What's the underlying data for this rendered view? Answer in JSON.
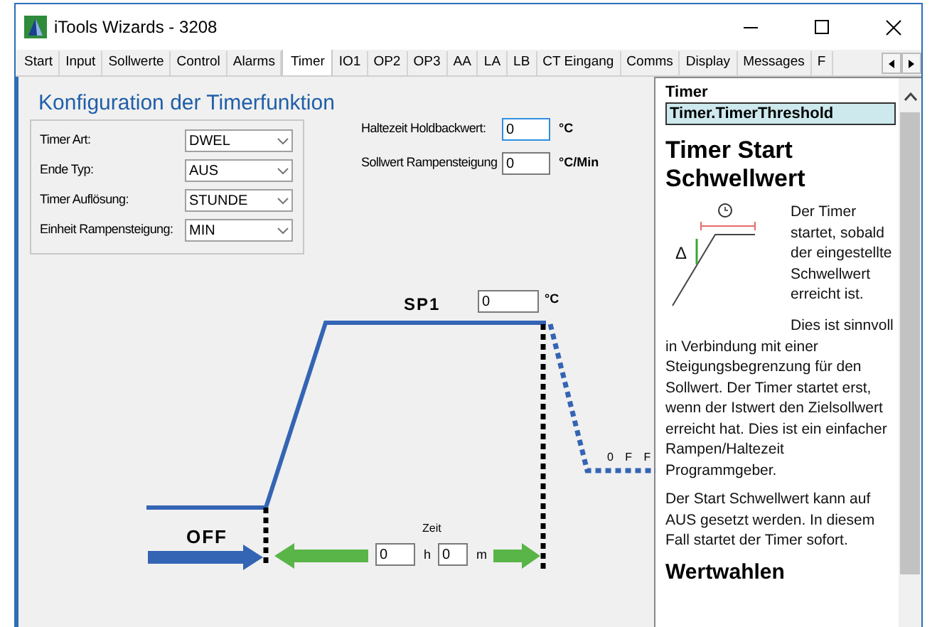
{
  "window": {
    "title": "iTools Wizards - 3208"
  },
  "tabs": [
    {
      "label": "Start",
      "selected": false
    },
    {
      "label": "Input",
      "selected": false
    },
    {
      "label": "Sollwerte",
      "selected": false
    },
    {
      "label": "Control",
      "selected": false
    },
    {
      "label": "Alarms",
      "selected": false
    },
    {
      "label": "Timer",
      "selected": true
    },
    {
      "label": "IO1",
      "selected": false
    },
    {
      "label": "OP2",
      "selected": false
    },
    {
      "label": "OP3",
      "selected": false
    },
    {
      "label": "AA",
      "selected": false
    },
    {
      "label": "LA",
      "selected": false
    },
    {
      "label": "LB",
      "selected": false
    },
    {
      "label": "CT Eingang",
      "selected": false
    },
    {
      "label": "Comms",
      "selected": false
    },
    {
      "label": "Display",
      "selected": false
    },
    {
      "label": "Messages",
      "selected": false
    },
    {
      "label": "F",
      "selected": false
    }
  ],
  "config": {
    "title": "Konfiguration der Timerfunktion",
    "settings": [
      {
        "label": "Timer Art:",
        "value": "DWEL"
      },
      {
        "label": "Ende Typ:",
        "value": "AUS"
      },
      {
        "label": "Timer Auflösung:",
        "value": "STUNDE"
      },
      {
        "label": "Einheit Rampensteigung:",
        "value": "MIN"
      }
    ],
    "fields": [
      {
        "label": "Haltezeit Holdbackwert:",
        "value": "0",
        "unit": "°C",
        "focused": true
      },
      {
        "label": "Sollwert Rampensteigung",
        "value": "0",
        "unit": "°C/Min",
        "focused": false
      }
    ]
  },
  "diagram": {
    "setpoint_label": "SP1",
    "setpoint_value": "0",
    "setpoint_unit": "°C",
    "off_label": "OFF",
    "end_label": "0 F F",
    "time_label": "Zeit",
    "hours": "0",
    "hours_unit": "h",
    "minutes": "0",
    "minutes_unit": "m"
  },
  "help": {
    "section": "Timer",
    "parameter": "Timer.TimerThreshold",
    "heading": "Timer Start Schwellwert",
    "figure_label": "Δ",
    "paragraphs": [
      "Der Timer startet, sobald der eingestellte Schwellwert erreicht ist.",
      "Dies ist sinnvoll in Verbindung mit einer Steigungsbegrenzung für den Sollwert. Der Timer startet erst, wenn der Istwert den Zielsollwert erreicht hat. Dies ist ein einfacher Rampen/Haltezeit Programmgeber.",
      "Der Start Schwellwert kann auf AUS gesetzt werden. In diesem Fall startet der Timer sofort."
    ],
    "subheading": "Wertwahlen"
  }
}
